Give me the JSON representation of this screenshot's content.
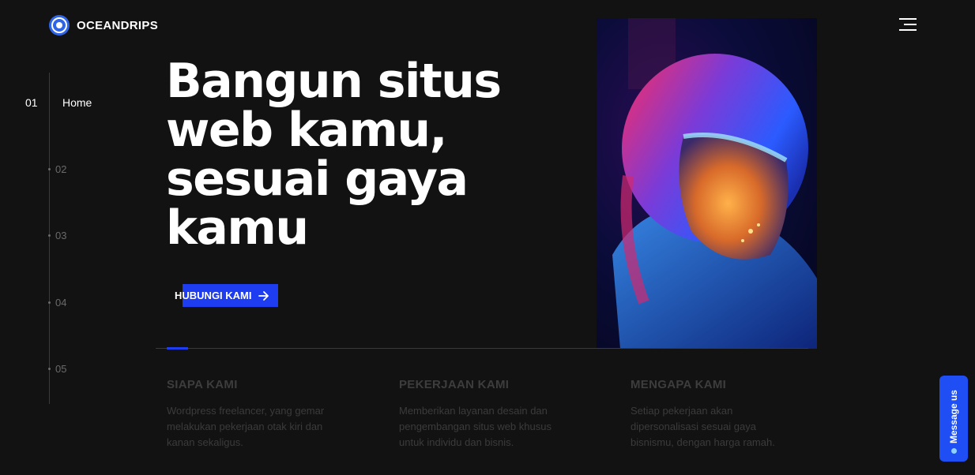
{
  "brand": {
    "name": "OCEANDRIPS"
  },
  "nav": {
    "active": {
      "number": "01",
      "label": "Home"
    },
    "items": [
      "02",
      "03",
      "04",
      "05"
    ]
  },
  "hero": {
    "headline": "Bangun situs web kamu, sesuai gaya kamu",
    "cta_label": "HUBUNGI KAMI",
    "image_alt": "astronaut-helmet-photo"
  },
  "columns": [
    {
      "title": "SIAPA KAMI",
      "text": "Wordpress freelancer, yang gemar melakukan pekerjaan otak kiri dan kanan sekaligus."
    },
    {
      "title": "PEKERJAAN KAMI",
      "text": "Memberikan layanan desain dan pengembangan situs web khusus untuk individu dan bisnis."
    },
    {
      "title": "MENGAPA KAMI",
      "text": "Setiap pekerjaan akan dipersonalisasi sesuai gaya bisnismu, dengan harga ramah."
    }
  ],
  "message_tab": {
    "label": "Message us"
  },
  "colors": {
    "accent": "#1f3df0",
    "background": "#121212"
  },
  "icons": {
    "menu": "hamburger-menu-icon",
    "cta": "arrow-right-icon",
    "logo": "logo-icon"
  }
}
